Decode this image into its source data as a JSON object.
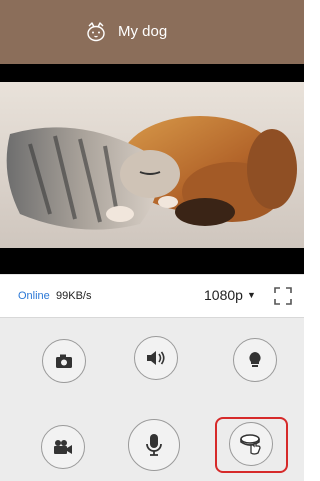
{
  "header": {
    "title": "My dog"
  },
  "status": {
    "online_label": "Online",
    "bitrate": "99KB/s"
  },
  "quality": {
    "label": "1080p",
    "caret": "▼"
  },
  "icons": {
    "header": "dog-face-icon",
    "fullscreen": "fullscreen-icon",
    "snapshot": "camera-icon",
    "audio": "speaker-icon",
    "light": "lightbulb-icon",
    "record": "video-camera-icon",
    "talk": "microphone-icon",
    "treat": "treat-toss-icon"
  },
  "colors": {
    "header_bg": "#8b6e5a",
    "online": "#2b78d6",
    "highlight": "#d62a2a",
    "controls_bg": "#ececec"
  }
}
